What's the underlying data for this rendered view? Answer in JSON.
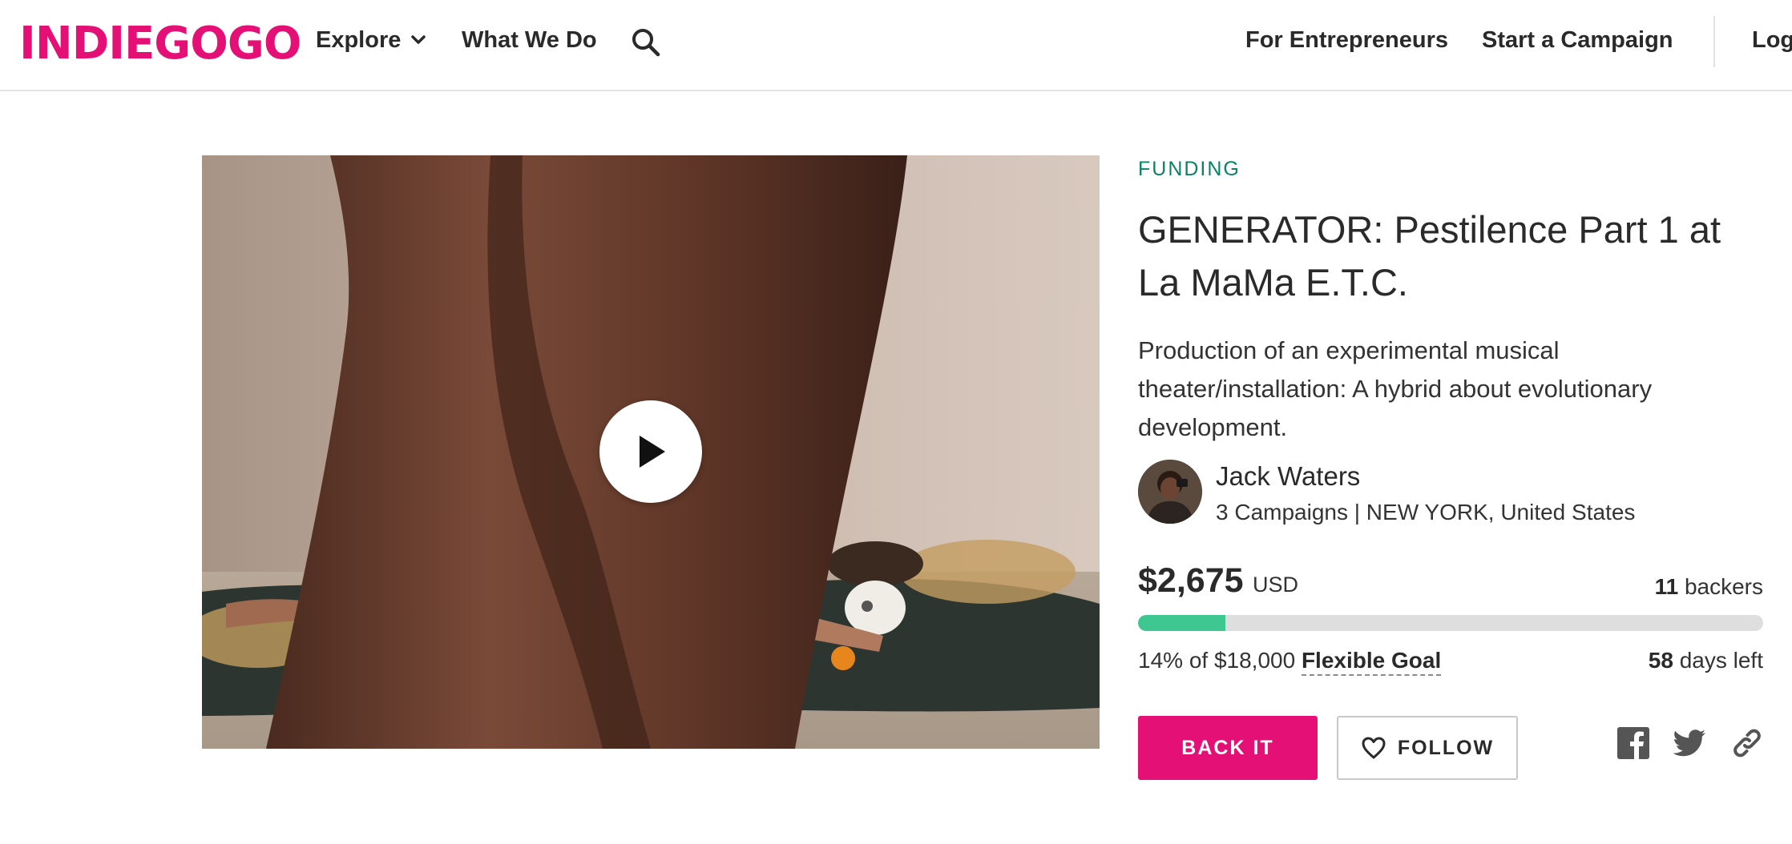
{
  "header": {
    "logo": "INDIEGOGO",
    "nav_explore": "Explore",
    "nav_what_we_do": "What We Do",
    "nav_for_entrepreneurs": "For Entrepreneurs",
    "nav_start_campaign": "Start a Campaign",
    "nav_login": "Log"
  },
  "campaign": {
    "status": "FUNDING",
    "title": "GENERATOR: Pestilence Part 1 at La MaMa E.T.C.",
    "tagline": "Production of an experimental musical theater/installation: A hybrid about evolutionary development.",
    "owner": {
      "name": "Jack Waters",
      "meta": "3 Campaigns | NEW YORK, United States"
    },
    "raised": "$2,675",
    "currency": "USD",
    "backers_count": "11",
    "backers_label": "backers",
    "progress_fraction": 0.14,
    "goal_text": "14% of $18,000",
    "goal_type": "Flexible Goal",
    "days_count": "58",
    "days_label": "days left"
  },
  "actions": {
    "back_it": "BACK IT",
    "follow": "FOLLOW"
  },
  "colors": {
    "brand": "#e51075",
    "funding_green": "#088366",
    "progress_green": "#3ec791"
  },
  "icons": [
    "chevron-down-icon",
    "search-icon",
    "play-icon",
    "heart-icon",
    "facebook-icon",
    "twitter-icon",
    "link-icon"
  ]
}
